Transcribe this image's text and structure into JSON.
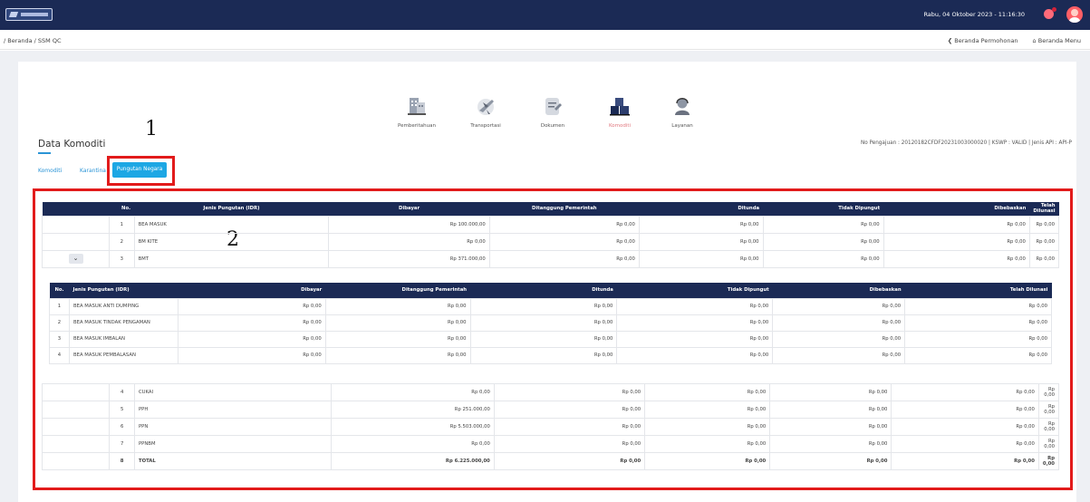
{
  "header": {
    "datetime": "Rabu, 04 Oktober 2023 - 11:16:30"
  },
  "breadcrumb": {
    "path": "/ Beranda / SSM QC",
    "link1": "❮ Beranda Permohonan",
    "link2": "⌂ Beranda Menu"
  },
  "menu": [
    {
      "label": "Pemberitahuan",
      "icon": "building-icon"
    },
    {
      "label": "Transportasi",
      "icon": "airplane-icon"
    },
    {
      "label": "Dokumen",
      "icon": "document-icon"
    },
    {
      "label": "Komoditi",
      "icon": "boxes-icon"
    },
    {
      "label": "Layanan",
      "icon": "support-agent-icon"
    }
  ],
  "page": {
    "title": "Data Komoditi",
    "info": "No Pengajuan : 20120182CFDF20231003000020 | KSWP : VALID | Jenis API : API-P"
  },
  "tabs": {
    "t1": "Komoditi",
    "t2": "Karantina",
    "active": "Pungutan Negara"
  },
  "annotations": {
    "a1": "1",
    "a2": "2"
  },
  "main_table": {
    "headers": [
      "No.",
      "Jenis Pungutan (IDR)",
      "Dibayar",
      "Ditanggung Pemerintah",
      "Ditunda",
      "Tidak Dipungut",
      "Dibebaskan",
      "Telah Dilunasi"
    ],
    "rows_top": [
      [
        "1",
        "BEA MASUK",
        "Rp 100.000,00",
        "Rp 0,00",
        "Rp 0,00",
        "Rp 0,00",
        "Rp 0,00",
        "Rp 0,00"
      ],
      [
        "2",
        "BM KITE",
        "Rp 0,00",
        "Rp 0,00",
        "Rp 0,00",
        "Rp 0,00",
        "Rp 0,00",
        "Rp 0,00"
      ],
      [
        "3",
        "BMT",
        "Rp 371.000,00",
        "Rp 0,00",
        "Rp 0,00",
        "Rp 0,00",
        "Rp 0,00",
        "Rp 0,00"
      ]
    ],
    "expand_symbol": "⌄",
    "rows_bottom": [
      [
        "4",
        "CUKAI",
        "Rp 0,00",
        "Rp 0,00",
        "Rp 0,00",
        "Rp 0,00",
        "Rp 0,00",
        "Rp 0,00"
      ],
      [
        "5",
        "PPH",
        "Rp 251.000,00",
        "Rp 0,00",
        "Rp 0,00",
        "Rp 0,00",
        "Rp 0,00",
        "Rp 0,00"
      ],
      [
        "6",
        "PPN",
        "Rp 5.503.000,00",
        "Rp 0,00",
        "Rp 0,00",
        "Rp 0,00",
        "Rp 0,00",
        "Rp 0,00"
      ],
      [
        "7",
        "PPNBM",
        "Rp 0,00",
        "Rp 0,00",
        "Rp 0,00",
        "Rp 0,00",
        "Rp 0,00",
        "Rp 0,00"
      ],
      [
        "8",
        "TOTAL",
        "Rp 6.225.000,00",
        "Rp 0,00",
        "Rp 0,00",
        "Rp 0,00",
        "Rp 0,00",
        "Rp 0,00"
      ]
    ]
  },
  "sub_table": {
    "headers": [
      "No.",
      "Jenis Pungutan (IDR)",
      "Dibayar",
      "Ditanggung Pemerintah",
      "Ditunda",
      "Tidak Dipungut",
      "Dibebaskan",
      "Telah Dilunasi"
    ],
    "rows": [
      [
        "1",
        "BEA MASUK ANTI DUMPING",
        "Rp 0,00",
        "Rp 0,00",
        "Rp 0,00",
        "Rp 0,00",
        "Rp 0,00",
        "Rp 0,00"
      ],
      [
        "2",
        "BEA MASUK TINDAK PENGAMAN",
        "Rp 0,00",
        "Rp 0,00",
        "Rp 0,00",
        "Rp 0,00",
        "Rp 0,00",
        "Rp 0,00"
      ],
      [
        "3",
        "BEA MASUK IMBALAN",
        "Rp 0,00",
        "Rp 0,00",
        "Rp 0,00",
        "Rp 0,00",
        "Rp 0,00",
        "Rp 0,00"
      ],
      [
        "4",
        "BEA MASUK PEMBALASAN",
        "Rp 0,00",
        "Rp 0,00",
        "Rp 0,00",
        "Rp 0,00",
        "Rp 0,00",
        "Rp 0,00"
      ]
    ]
  }
}
